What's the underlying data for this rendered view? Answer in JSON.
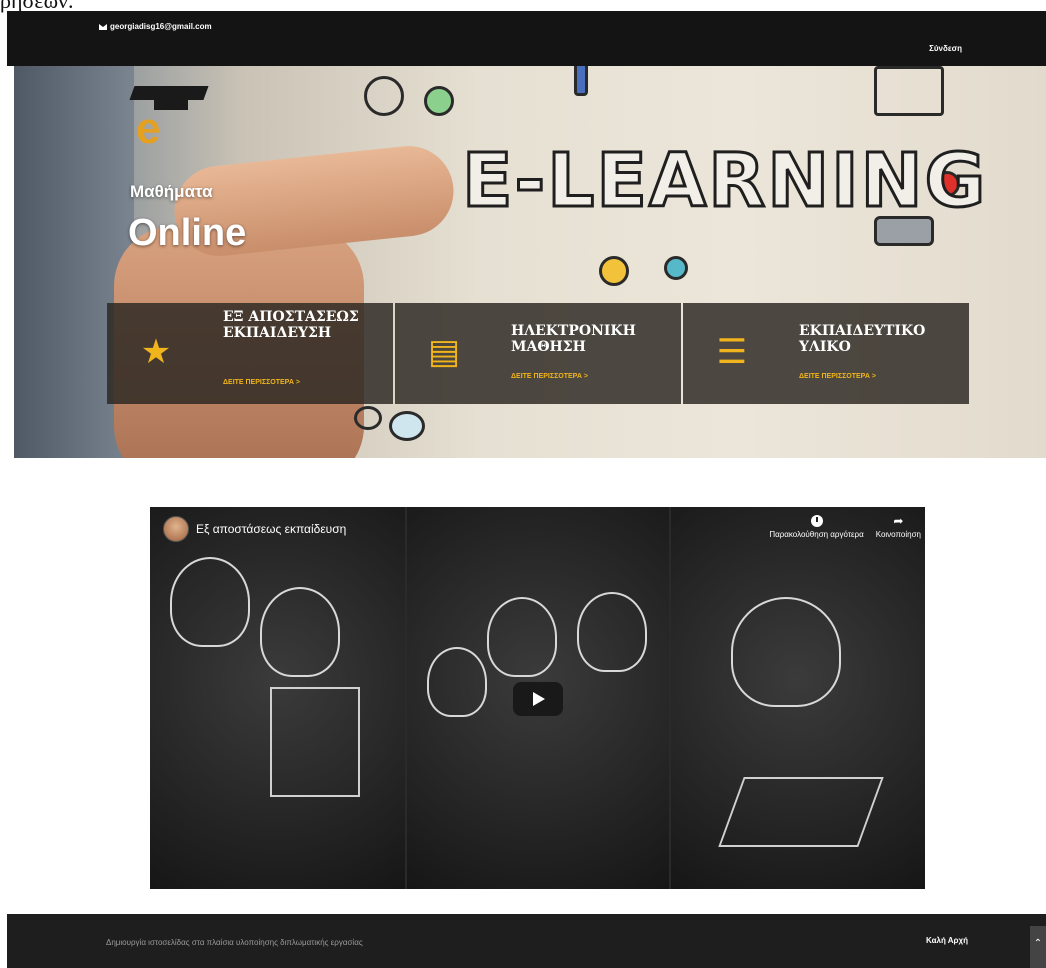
{
  "document_fragment": "ρήσεων.",
  "topbar": {
    "email": "georgiadisg16@gmail.com",
    "login": "Σύνδεση"
  },
  "hero": {
    "image_text": "E-LEARNING",
    "subtitle": "Μαθήματα",
    "headline": "Online",
    "cards": [
      {
        "title": "ΕΞ ΑΠΟΣΤΑΣΕΩΣ ΕΚΠΑΙΔΕΥΣΗ",
        "more": "ΔΕΙΤΕ ΠΕΡΙΣΣΟΤΕΡΑ >",
        "icon": "laurel-star-icon"
      },
      {
        "title": "ΗΛΕΚΤΡΟΝΙΚΗ ΜΑΘΗΣΗ",
        "more": "ΔΕΙΤΕ ΠΕΡΙΣΣΟΤΕΡΑ >",
        "icon": "open-book-icon"
      },
      {
        "title": "ΕΚΠΑΙΔΕΥΤΙΚΟ ΥΛΙΚΟ",
        "more": "ΔΕΙΤΕ ΠΕΡΙΣΣΟΤΕΡΑ >",
        "icon": "books-stack-icon"
      }
    ]
  },
  "video": {
    "title": "Εξ αποστάσεως εκπαίδευση",
    "watch_later": "Παρακολούθηση αργότερα",
    "share": "Κοινοποίηση"
  },
  "footer": {
    "credit": "Δημιουργία ιστοσελίδας στα πλαίσια υλοποίησης διπλωματικής εργασίας",
    "home": "Καλή Αρχή"
  },
  "colors": {
    "accent": "#f0b41c",
    "bar": "#141414",
    "footer": "#1e1e1e"
  }
}
